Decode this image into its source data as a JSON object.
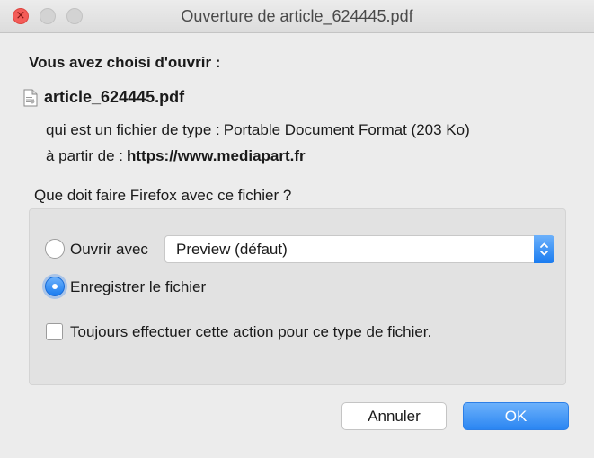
{
  "window": {
    "title": "Ouverture de article_624445.pdf"
  },
  "dialog": {
    "heading": "Vous avez choisi d'ouvrir :",
    "file_name": "article_624445.pdf",
    "file_icon": "document-icon",
    "type_label": "qui est un fichier de type :",
    "type_value": "Portable Document Format (203 Ko)",
    "source_label": "à partir de :",
    "source_value": "https://www.mediapart.fr",
    "question": "Que doit faire Firefox avec ce fichier ?"
  },
  "options": {
    "open_with": {
      "label": "Ouvrir avec",
      "selected": false,
      "app_value": "Preview (défaut)"
    },
    "save_file": {
      "label": "Enregistrer le fichier",
      "selected": true
    },
    "always": {
      "label": "Toujours effectuer cette action pour ce type de fichier.",
      "checked": false
    }
  },
  "buttons": {
    "cancel": "Annuler",
    "ok": "OK"
  },
  "colors": {
    "close": "#f35c58",
    "accent": "#1a7cf0",
    "window_bg": "#ececec",
    "group_bg": "#e2e2e2"
  }
}
